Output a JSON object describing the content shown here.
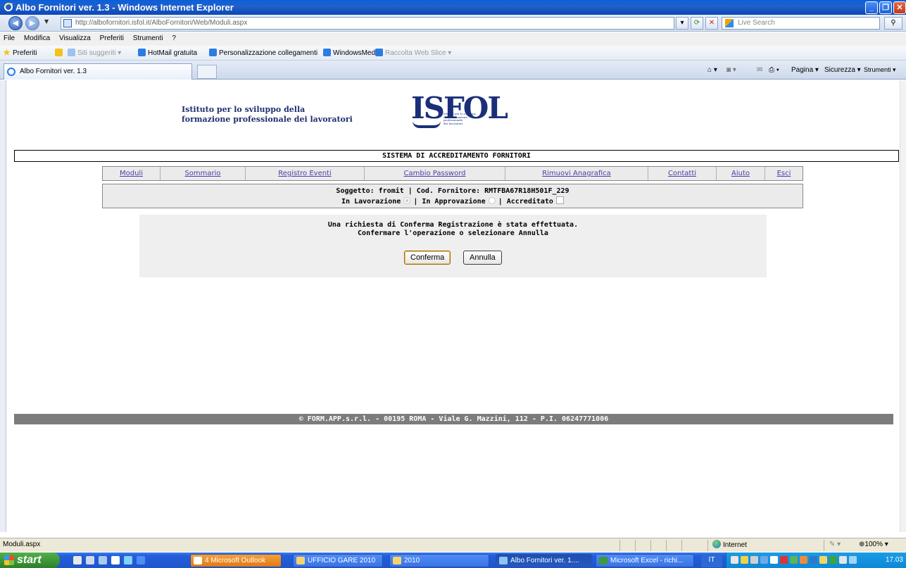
{
  "window": {
    "title": "Albo Fornitori ver. 1.3 - Windows Internet Explorer"
  },
  "browser": {
    "url": "http://albofornitori.isfol.it/AlboFornitori/Web/Moduli.aspx",
    "search_placeholder": "Live Search",
    "menu": [
      "File",
      "Modifica",
      "Visualizza",
      "Preferiti",
      "Strumenti",
      "?"
    ],
    "favorites_label": "Preferiti",
    "favorites": [
      "Siti suggeriti ▾",
      "HotMail gratuita",
      "Personalizzazione collegamenti",
      "WindowsMedia",
      "Raccolta Web Slice ▾"
    ],
    "tab_title": "Albo Fornitori ver. 1.3",
    "tools": [
      "Pagina ▾",
      "Sicurezza ▾",
      "Strumenti ▾"
    ],
    "status_text": "Moduli.aspx",
    "zone": "Internet",
    "zoom": "100%"
  },
  "page": {
    "org_line1": "Istituto per lo sviluppo della",
    "org_line2": "formazione professionale dei lavoratori",
    "logo_text": "ISFOL",
    "logo_sub": [
      "Istituto per lo sviluppo",
      "della formazione",
      "professionale",
      "dei lavoratori"
    ],
    "system_title": "SISTEMA DI ACCREDITAMENTO FORNITORI",
    "nav": [
      "Moduli",
      "Sommario",
      "Registro Eventi",
      "Cambio Password",
      "Rimuovi Anagrafica",
      "Contatti",
      "Aiuto",
      "Esci"
    ],
    "status_line1": "Soggetto: fromit  | Cod. Fornitore: RMTFBA67R18H501F_229",
    "status_in_lavorazione": "In Lavorazione",
    "status_in_approvazione": "| In Approvazione",
    "status_accreditato": "| Accreditato",
    "confirm_line1": "Una richiesta di Conferma Registrazione  è stata effettuata.",
    "confirm_line2": "Confermare l'operazione o selezionare Annulla",
    "confirm_button": "Conferma",
    "cancel_button": "Annulla",
    "footer": "© FORM.APP.s.r.l. - 00195 ROMA - Viale G. Mazzini, 112 - P.I. 06247771006"
  },
  "taskbar": {
    "start": "start",
    "tasks": [
      "4 Microsoft Outlook",
      "UFFICIO GARE 2010",
      "2010",
      "Albo Fornitori ver. 1....",
      "Microsoft Excel - richi..."
    ],
    "lang": "IT",
    "clock": "17.03"
  },
  "colors": {
    "nav_link": "#4a3fa8",
    "org_text": "#1f2f6e",
    "footer_bg": "#7c7c7c"
  }
}
